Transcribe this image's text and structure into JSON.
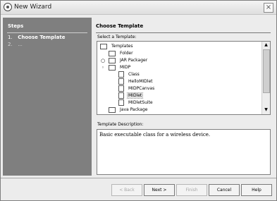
{
  "window": {
    "title": "New Wizard"
  },
  "steps": {
    "heading": "Steps",
    "items": [
      {
        "num": "1.",
        "label": "Choose Template"
      },
      {
        "num": "2.",
        "label": "..."
      }
    ]
  },
  "content": {
    "heading": "Choose Template",
    "select_label": "Select a Template:",
    "tree": [
      {
        "label": "Templates"
      },
      {
        "label": "Folder"
      },
      {
        "label": "JAR Packager"
      },
      {
        "label": "MIDP"
      },
      {
        "label": "Class"
      },
      {
        "label": "HelloMIDlet"
      },
      {
        "label": "MIDPCanvas"
      },
      {
        "label": "MIDlet"
      },
      {
        "label": "MIDletSuite"
      },
      {
        "label": "Java Package"
      }
    ],
    "description_label": "Template Description:",
    "description": "Basic executable class for a wireless device."
  },
  "buttons": {
    "back": "< Back",
    "next": "Next >",
    "finish": "Finish",
    "cancel": "Cancel",
    "help": "Help"
  }
}
